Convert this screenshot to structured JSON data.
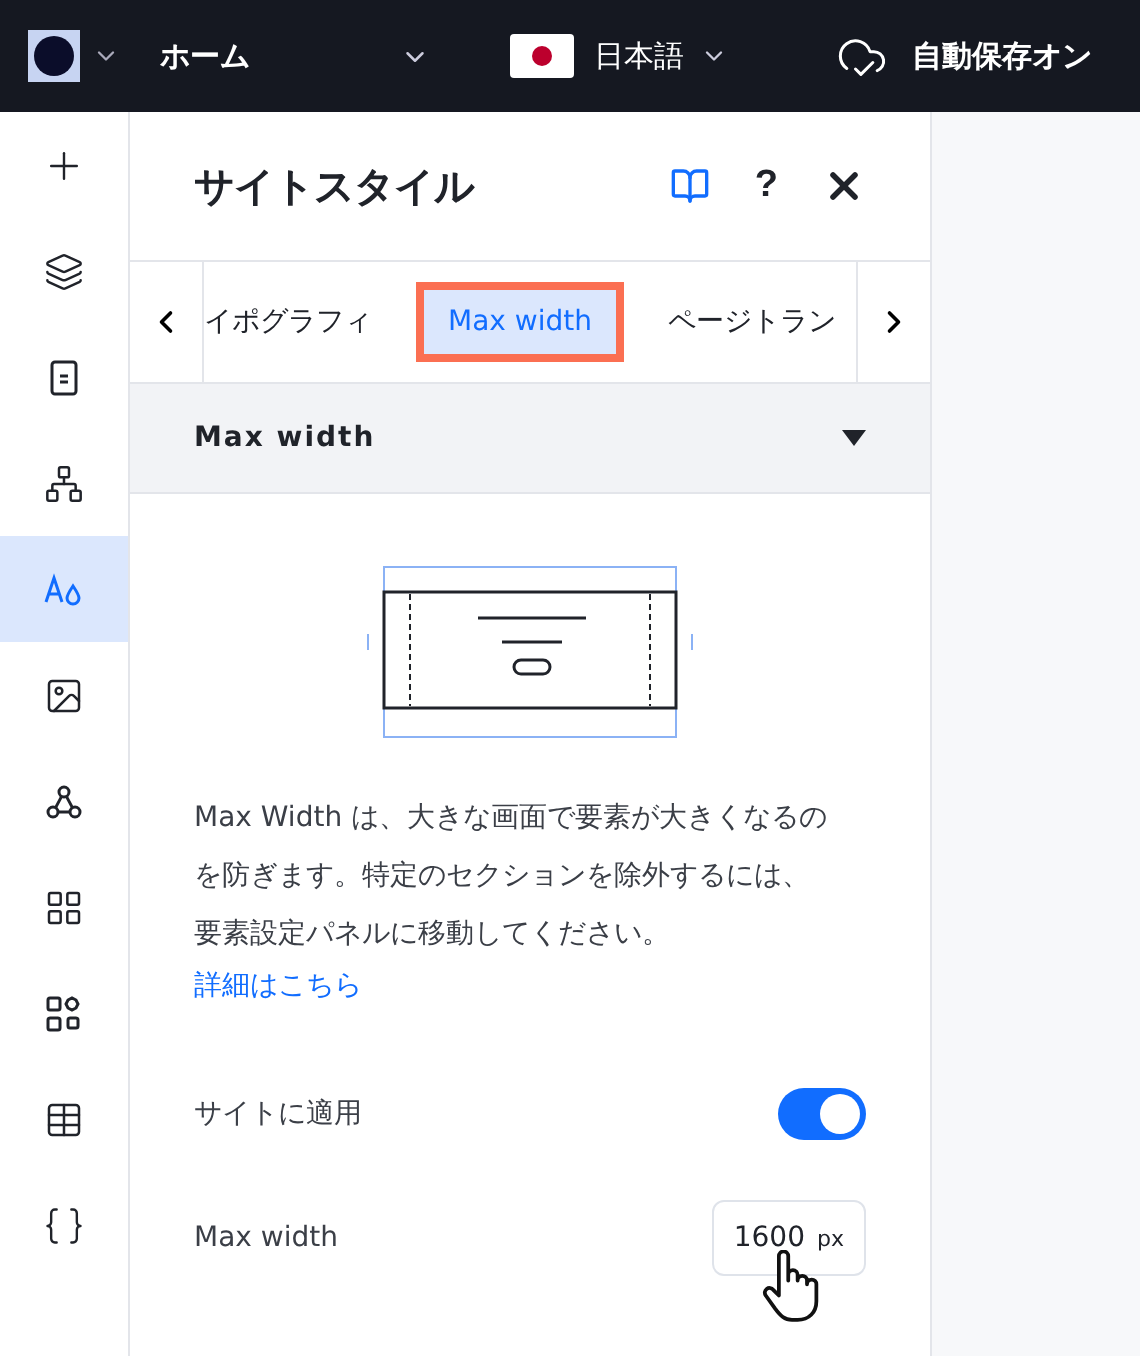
{
  "top_bar": {
    "page": "ホーム",
    "language": "日本語",
    "autosave": "自動保存オン"
  },
  "rail": [
    {
      "selected": false
    },
    {
      "selected": false
    },
    {
      "selected": false
    },
    {
      "selected": false
    },
    {
      "selected": true
    },
    {
      "selected": false
    },
    {
      "selected": false
    },
    {
      "selected": false
    },
    {
      "selected": false
    },
    {
      "selected": false
    },
    {
      "selected": false
    }
  ],
  "panel": {
    "title": "サイトスタイル",
    "help": "?",
    "tabs": [
      {
        "label": "イポグラフィ",
        "selected": false
      },
      {
        "label": "Max width",
        "selected": true
      },
      {
        "label": "ページトラン",
        "selected": false
      }
    ],
    "section": {
      "title": "Max width",
      "expanded": true
    },
    "description": "Max Width は、大きな画面で要素が大きくなるのを防ぎます。特定のセクションを除外するには、要素設定パネルに移動してください。",
    "link": "詳細はこちら",
    "apply_toggle": {
      "label": "サイトに適用",
      "on": true
    },
    "max_width": {
      "label": "Max width",
      "value": "1600",
      "unit": "px"
    }
  }
}
